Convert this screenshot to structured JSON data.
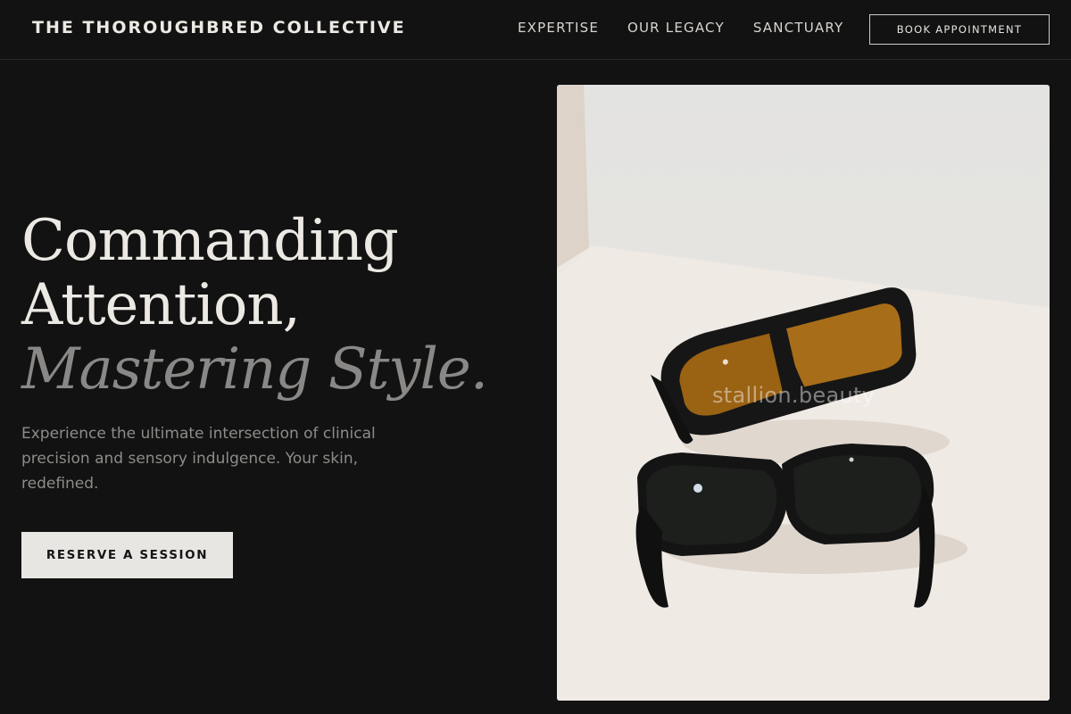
{
  "header": {
    "brand": "THE THOROUGHBRED COLLECTIVE",
    "nav": [
      "EXPERTISE",
      "OUR LEGACY",
      "SANCTUARY"
    ],
    "book_label": "BOOK APPOINTMENT"
  },
  "hero": {
    "headline_line1": "Commanding",
    "headline_line2": "Attention,",
    "headline_accent": "Mastering Style.",
    "subcopy": "Experience the ultimate intersection of clinical precision and sensory indulgence. Your skin, redefined.",
    "cta_label": "RESERVE A SESSION"
  },
  "image": {
    "subject": "two pairs of protective laser safety glasses on a white surface",
    "watermark": "stallion.beauty"
  },
  "colors": {
    "background": "#121212",
    "text": "#ece9e4",
    "muted": "#8e8c89",
    "cta_background": "#e8e6e3"
  }
}
